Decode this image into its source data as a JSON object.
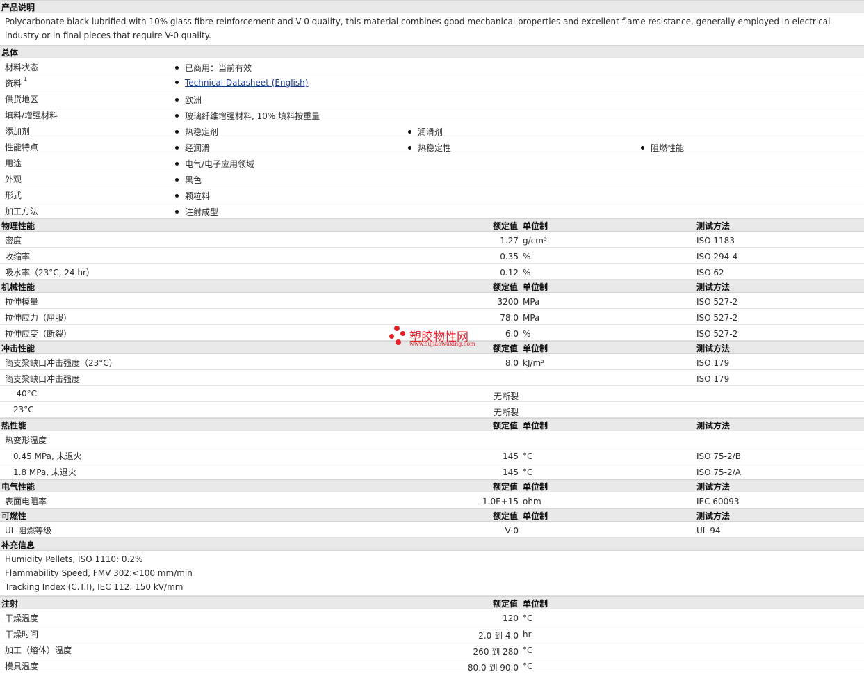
{
  "desc_section": {
    "title": "产品说明",
    "text": "Polycarbonate black lubrified with 10% glass fibre reinforcement and V-0 quality, this material combines good mechanical properties and excellent flame resistance, generally employed in electrical industry or in final pieces that require V-0 quality."
  },
  "general": {
    "title": "总体",
    "rows": [
      {
        "label": "材料状态",
        "items": [
          "已商用：当前有效"
        ]
      },
      {
        "label": "资料",
        "sup": "1",
        "items": [
          "Technical Datasheet (English)"
        ]
      },
      {
        "label": "供货地区",
        "items": [
          "欧洲"
        ]
      },
      {
        "label": "填料/增强材料",
        "items": [
          "玻璃纤维增强材料, 10% 填料按重量"
        ]
      },
      {
        "label": "添加剂",
        "items": [
          "热稳定剂",
          "润滑剂"
        ]
      },
      {
        "label": "性能特点",
        "items": [
          "经润滑",
          "热稳定性",
          "阻燃性能"
        ]
      },
      {
        "label": "用途",
        "items": [
          "电气/电子应用领域"
        ]
      },
      {
        "label": "外观",
        "items": [
          "黑色"
        ]
      },
      {
        "label": "形式",
        "items": [
          "颗粒料"
        ]
      },
      {
        "label": "加工方法",
        "items": [
          "注射成型"
        ]
      }
    ]
  },
  "headers": {
    "value": "额定值",
    "unit": "单位制",
    "method": "测试方法"
  },
  "physical": {
    "title": "物理性能",
    "rows": [
      {
        "label": "密度",
        "value": "1.27",
        "unit": "g/cm³",
        "method": "ISO 1183"
      },
      {
        "label": "收缩率",
        "value": "0.35",
        "unit": "%",
        "method": "ISO 294-4"
      },
      {
        "label": "吸水率（23°C, 24 hr）",
        "value": "0.12",
        "unit": "%",
        "method": "ISO 62"
      }
    ]
  },
  "mechanical": {
    "title": "机械性能",
    "rows": [
      {
        "label": "拉伸模量",
        "value": "3200",
        "unit": "MPa",
        "method": "ISO 527-2"
      },
      {
        "label": "拉伸应力（屈服）",
        "value": "78.0",
        "unit": "MPa",
        "method": "ISO 527-2"
      },
      {
        "label": "拉伸应变（断裂）",
        "value": "6.0",
        "unit": "%",
        "method": "ISO 527-2"
      }
    ]
  },
  "impact": {
    "title": "冲击性能",
    "rows": [
      {
        "label": "简支梁缺口冲击强度（23°C）",
        "value": "8.0",
        "unit": "kJ/m²",
        "method": "ISO 179"
      },
      {
        "label": "简支梁缺口冲击强度",
        "value": "",
        "unit": "",
        "method": "ISO 179"
      },
      {
        "label": "-40°C",
        "indent": true,
        "value": "无断裂",
        "unit": "",
        "method": ""
      },
      {
        "label": "23°C",
        "indent": true,
        "value": "无断裂",
        "unit": "",
        "method": ""
      }
    ]
  },
  "thermal": {
    "title": "热性能",
    "rows": [
      {
        "label": "热变形温度",
        "value": "",
        "unit": "",
        "method": ""
      },
      {
        "label": "0.45 MPa, 未退火",
        "indent": true,
        "value": "145",
        "unit": "°C",
        "method": "ISO 75-2/B"
      },
      {
        "label": "1.8 MPa, 未退火",
        "indent": true,
        "value": "145",
        "unit": "°C",
        "method": "ISO 75-2/A"
      }
    ]
  },
  "electrical": {
    "title": "电气性能",
    "rows": [
      {
        "label": "表面电阻率",
        "value": "1.0E+15",
        "unit": "ohm",
        "method": "IEC 60093"
      }
    ]
  },
  "flammability": {
    "title": "可燃性",
    "rows": [
      {
        "label": "UL 阻燃等级",
        "value": "V-0",
        "unit": "",
        "method": "UL 94"
      }
    ]
  },
  "supplement": {
    "title": "补充信息",
    "lines": [
      "Humidity Pellets, ISO 1110: 0.2%",
      "Flammability Speed, FMV 302:<100 mm/min",
      "Tracking Index (C.T.I), IEC 112: 150 kV/mm"
    ]
  },
  "injection": {
    "title": "注射",
    "rows": [
      {
        "label": "干燥温度",
        "value": "120",
        "unit": "°C"
      },
      {
        "label": "干燥时间",
        "value": "2.0 到  4.0",
        "unit": "hr"
      },
      {
        "label": "加工（熔体）温度",
        "value": "260 到  280",
        "unit": "°C"
      },
      {
        "label": "模具温度",
        "value": "80.0 到  90.0",
        "unit": "°C"
      }
    ]
  },
  "watermark": {
    "cn": "塑胶物性网",
    "en": "www.sujiaowuxing.com",
    "color": "#e6212a"
  }
}
